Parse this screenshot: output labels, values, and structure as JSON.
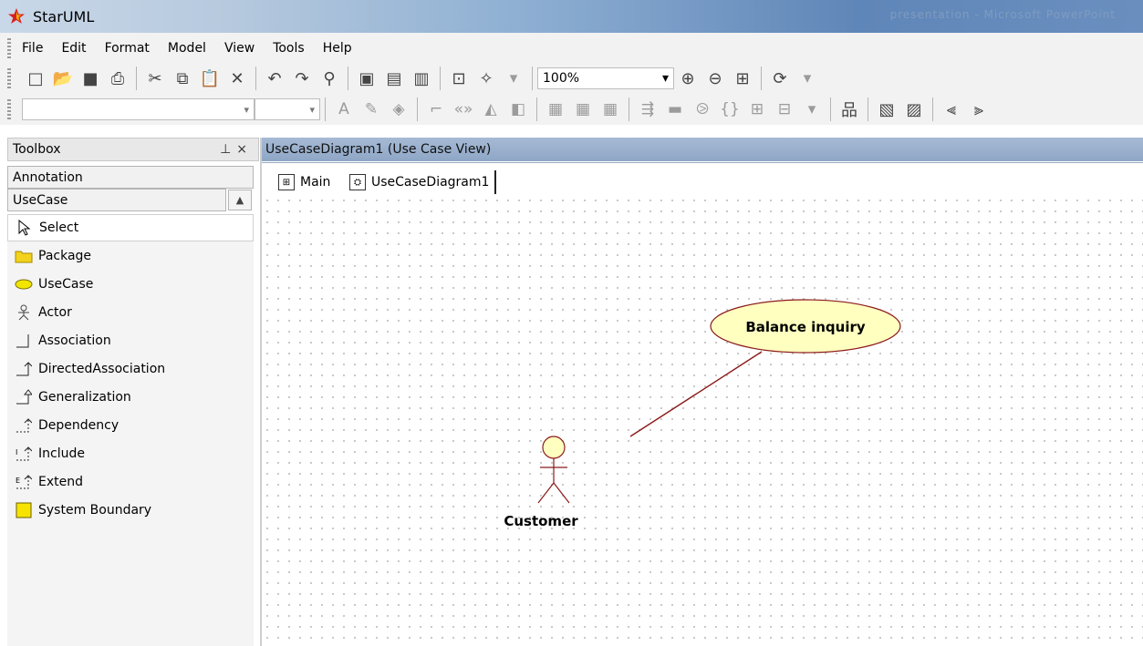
{
  "window": {
    "title": "StarUML",
    "background_ghost": "presentation - Microsoft PowerPoint"
  },
  "menu": [
    "File",
    "Edit",
    "Format",
    "Model",
    "View",
    "Tools",
    "Help"
  ],
  "toolbar": {
    "zoom_value": "100%"
  },
  "toolbox": {
    "title": "Toolbox",
    "categories": {
      "annotation": "Annotation",
      "usecase": "UseCase"
    },
    "items": [
      {
        "label": "Select",
        "icon": "cursor-icon"
      },
      {
        "label": "Package",
        "icon": "folder-icon"
      },
      {
        "label": "UseCase",
        "icon": "ellipse-icon"
      },
      {
        "label": "Actor",
        "icon": "actor-icon"
      },
      {
        "label": "Association",
        "icon": "association-icon"
      },
      {
        "label": "DirectedAssociation",
        "icon": "directed-association-icon"
      },
      {
        "label": "Generalization",
        "icon": "generalization-icon"
      },
      {
        "label": "Dependency",
        "icon": "dependency-icon"
      },
      {
        "label": "Include",
        "icon": "include-icon"
      },
      {
        "label": "Extend",
        "icon": "extend-icon"
      },
      {
        "label": "System Boundary",
        "icon": "system-boundary-icon"
      }
    ]
  },
  "diagram": {
    "header": "UseCaseDiagram1 (Use Case View)",
    "tabs": [
      "Main",
      "UseCaseDiagram1"
    ],
    "usecase_label": "Balance inquiry",
    "actor_label": "Customer"
  },
  "colors": {
    "usecase_fill": "#ffffc0",
    "line": "#8b1a1a",
    "header": "#a6bad4"
  }
}
